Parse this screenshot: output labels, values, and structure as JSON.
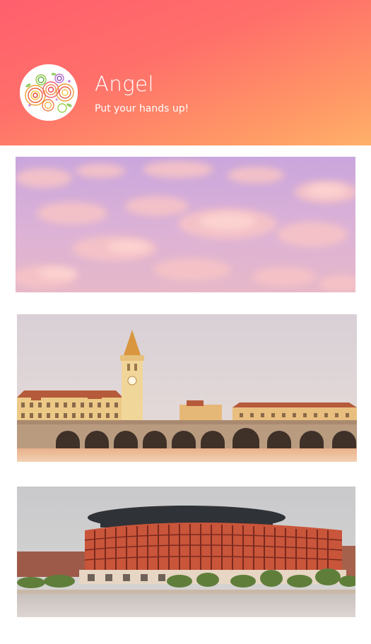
{
  "profile": {
    "name": "Angel",
    "tagline": "Put your hands up!",
    "avatar_icon": "colorful-rose-swirls-icon"
  },
  "colors": {
    "header_start": "#ff5f6d",
    "header_end": "#ffb06a",
    "background": "#ffffff"
  },
  "feed": {
    "cards": [
      {
        "kind": "photo",
        "subject": "pink-purple-cloudy-sky"
      },
      {
        "kind": "photo",
        "subject": "clock-tower-and-arched-stone-bridge"
      },
      {
        "kind": "photo",
        "subject": "oval-red-brick-arena-by-water"
      }
    ]
  }
}
